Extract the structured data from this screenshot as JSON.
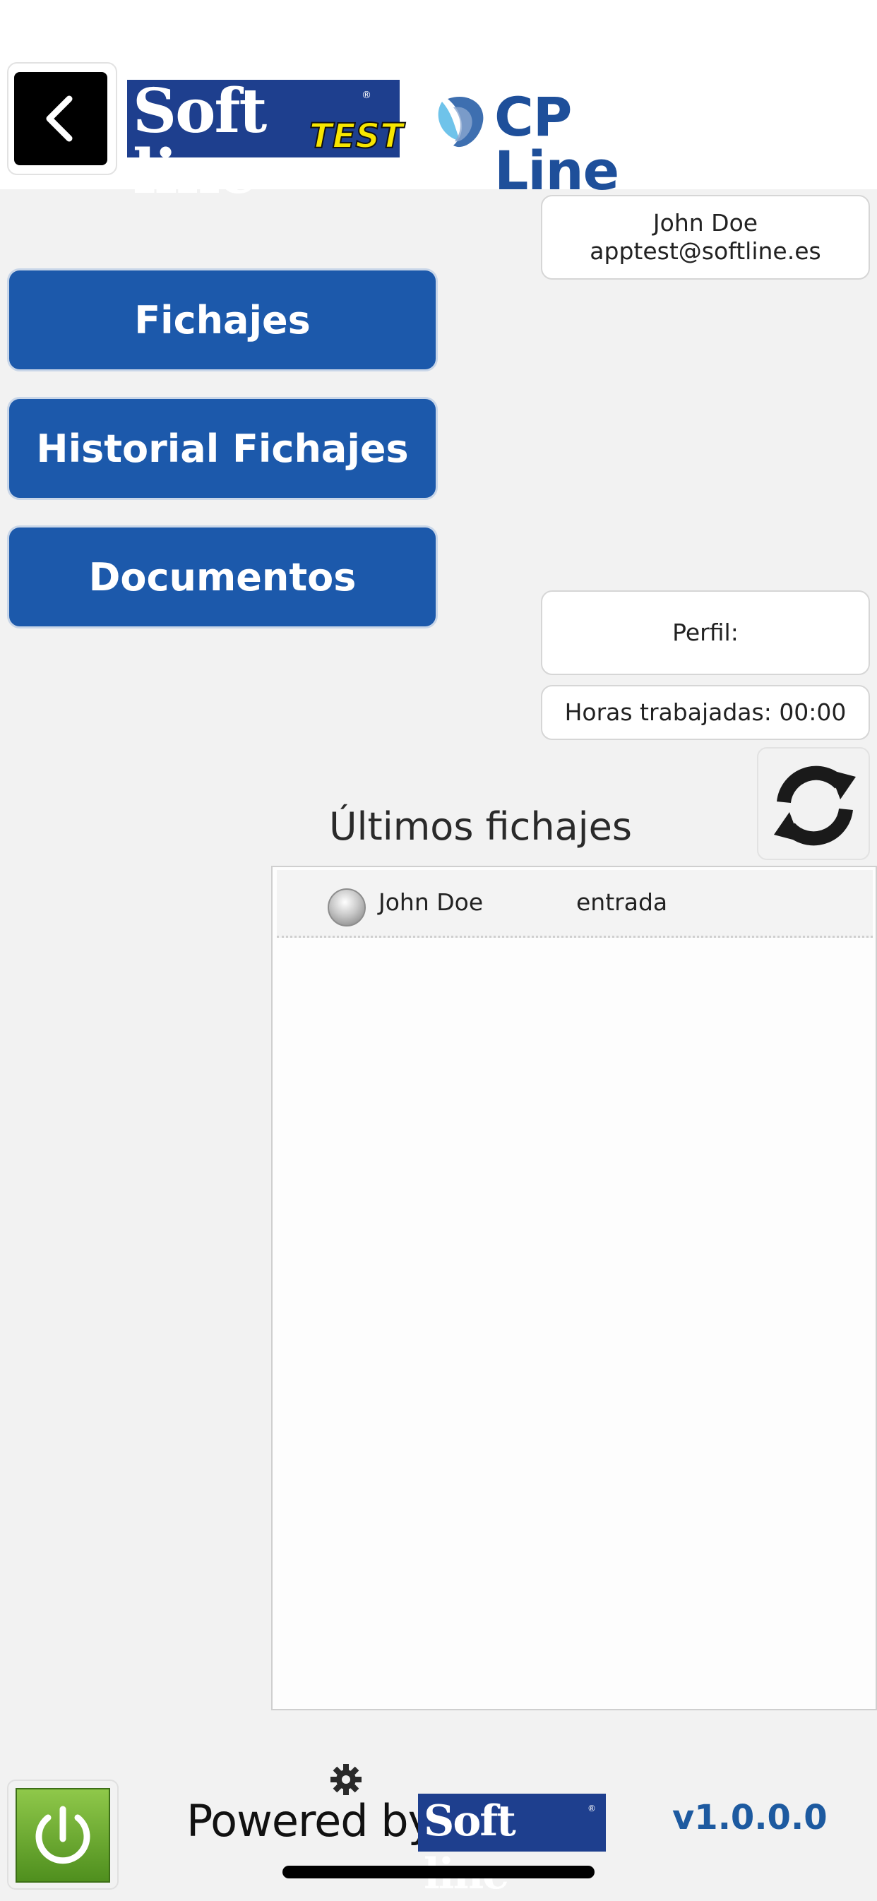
{
  "header": {
    "back_icon": "chevron-left-icon",
    "softline_logo": {
      "word": "Soft line",
      "reg": "®",
      "badge": "TEST"
    },
    "cpline_logo": {
      "text": "CP Line"
    }
  },
  "user": {
    "name": "John Doe",
    "email": "apptest@softline.es"
  },
  "menu": {
    "fichajes": "Fichajes",
    "historial": "Historial Fichajes",
    "documentos": "Documentos"
  },
  "perfil": {
    "label": "Perfil:"
  },
  "horas": {
    "text": "Horas trabajadas: 00:00"
  },
  "refresh_icon": "refresh-icon",
  "ultimos": {
    "title": "Últimos fichajes",
    "rows": [
      {
        "name": "John Doe",
        "type": "entrada"
      }
    ]
  },
  "footer": {
    "power_icon": "power-icon",
    "settings_icon": "gear-icon",
    "powered_by": "Powered by",
    "logo_word": "Soft line",
    "logo_reg": "®",
    "version": "v1.0.0.0"
  },
  "colors": {
    "primary_blue": "#1c59ab",
    "logo_blue": "#1e3f8e",
    "test_yellow": "#f7e600",
    "power_green": "#6aa82f",
    "version_blue": "#1d5aa0"
  }
}
